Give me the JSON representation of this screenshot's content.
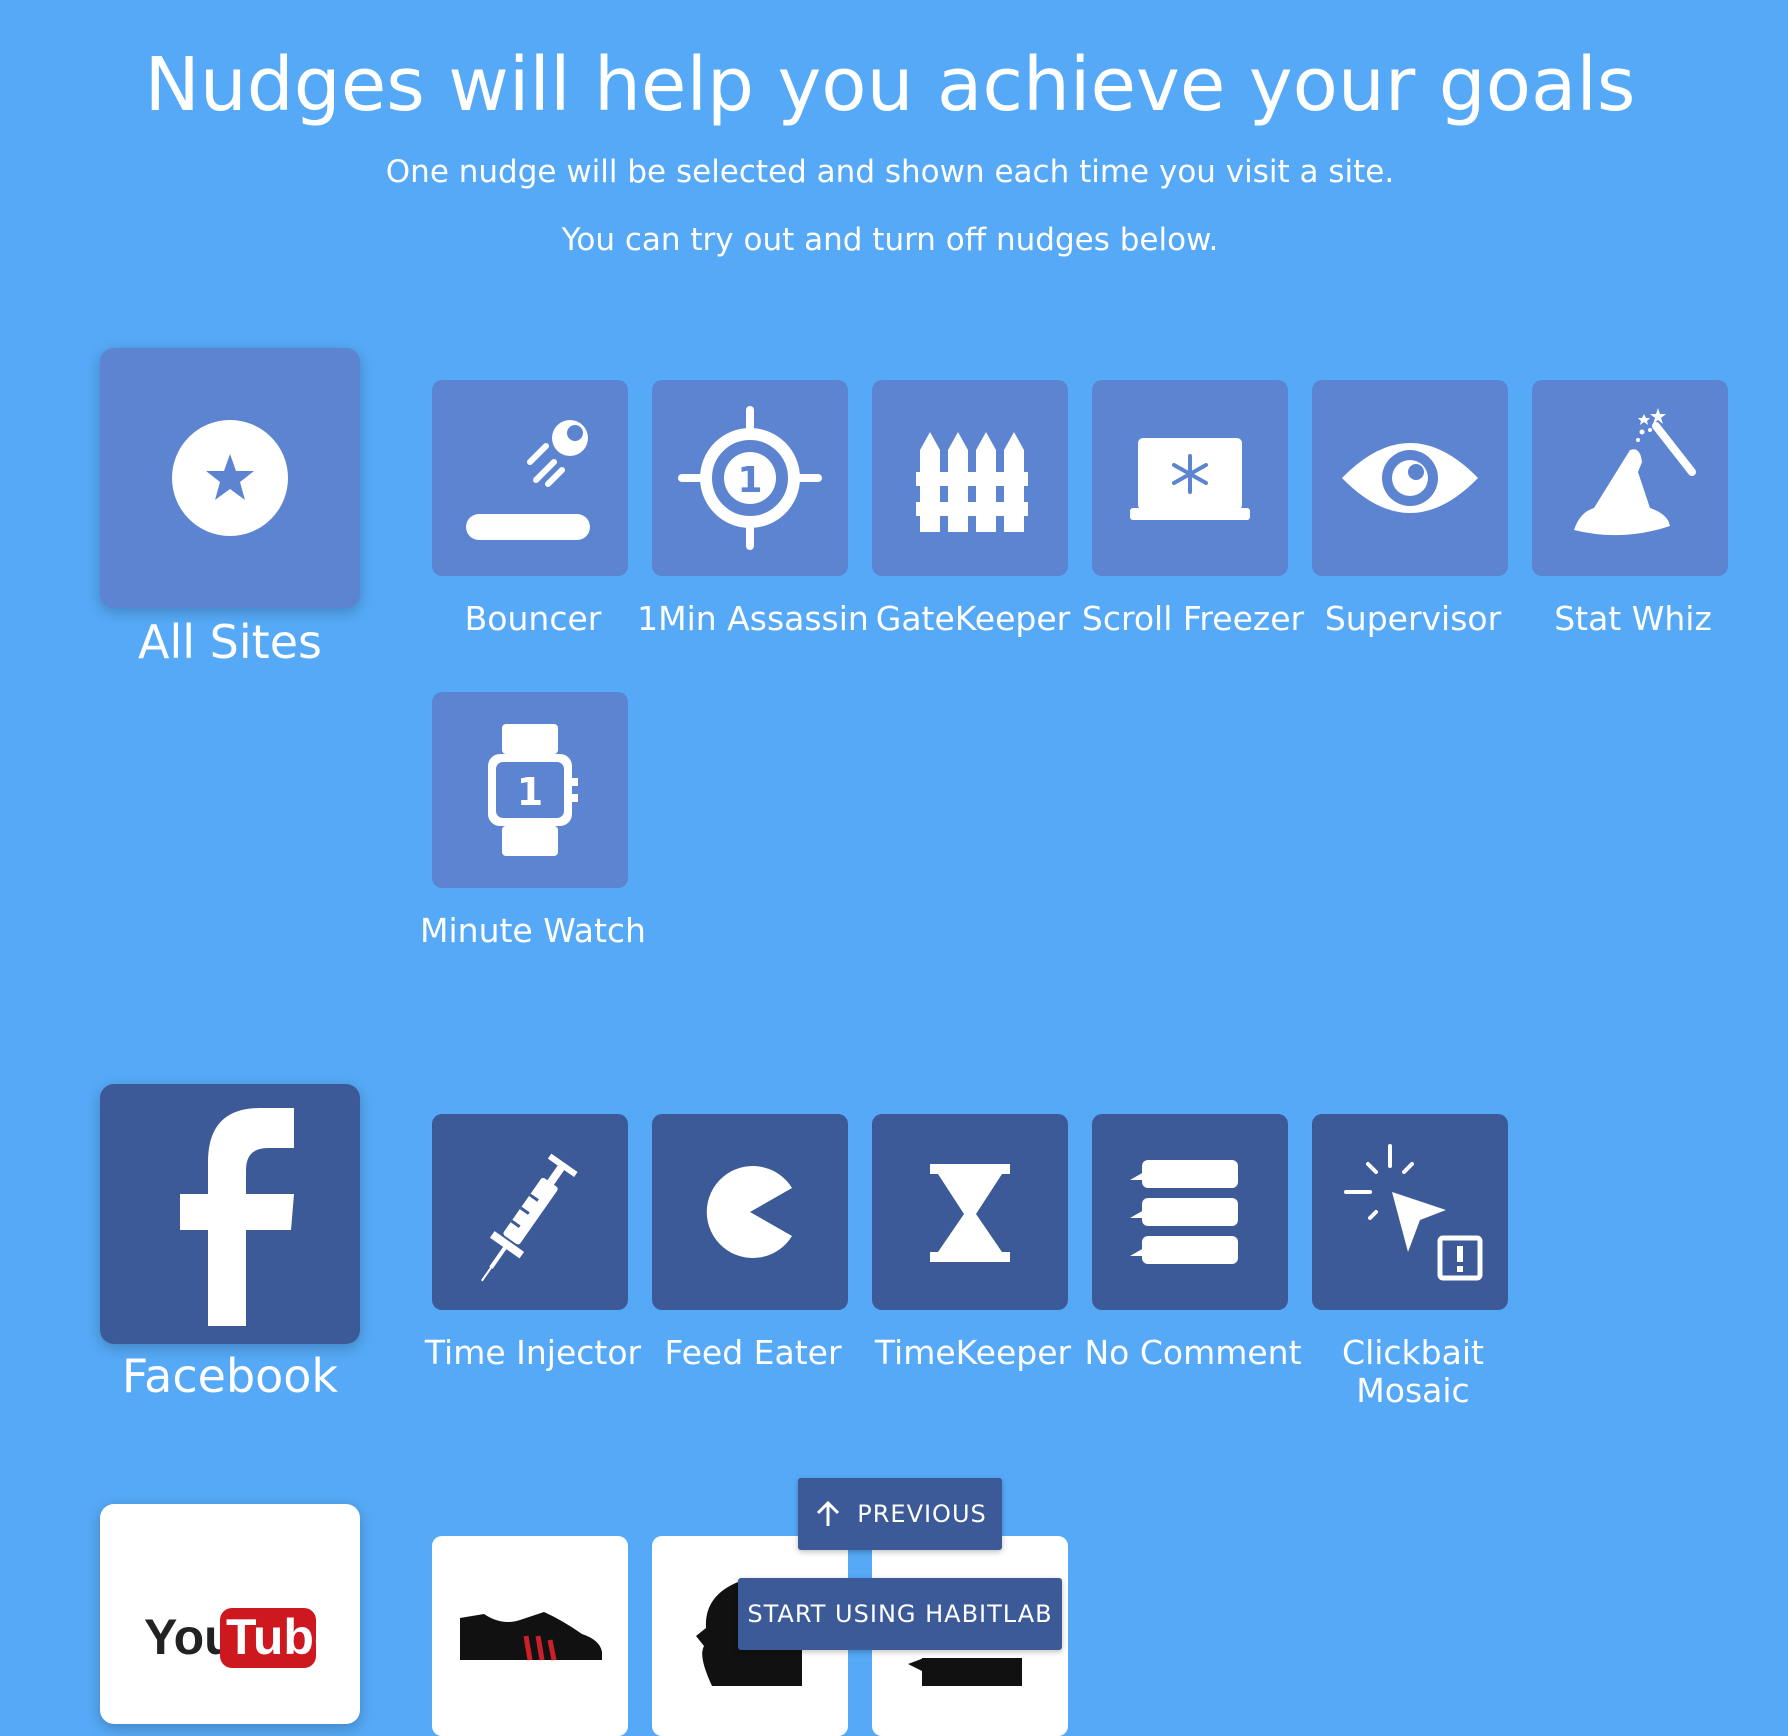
{
  "header": {
    "title": "Nudges will help you achieve your goals",
    "line1": "One nudge will be selected and shown each time you visit a site.",
    "line2": "You can try out and turn off nudges below."
  },
  "sites": [
    {
      "label": "All Sites",
      "icon": "star-circle-icon",
      "color": "#5c84d1",
      "nudges": [
        {
          "label": "Bouncer",
          "icon": "bouncer-icon"
        },
        {
          "label": "1Min Assassin",
          "icon": "crosshair-icon"
        },
        {
          "label": "GateKeeper",
          "icon": "fence-icon"
        },
        {
          "label": "Scroll Freezer",
          "icon": "laptop-snowflake-icon"
        },
        {
          "label": "Supervisor",
          "icon": "eye-icon"
        },
        {
          "label": "Stat Whiz",
          "icon": "wizard-hat-icon"
        },
        {
          "label": "Minute Watch",
          "icon": "smartwatch-icon"
        }
      ]
    },
    {
      "label": "Facebook",
      "icon": "facebook-icon",
      "color": "#3d5a98",
      "nudges": [
        {
          "label": "Time Injector",
          "icon": "syringe-icon"
        },
        {
          "label": "Feed Eater",
          "icon": "pacman-icon"
        },
        {
          "label": "TimeKeeper",
          "icon": "hourglass-icon"
        },
        {
          "label": "No Comment",
          "icon": "comments-icon"
        },
        {
          "label": "Clickbait Mosaic",
          "icon": "cursor-alert-icon"
        }
      ]
    },
    {
      "label": "YouTube",
      "logo_text": [
        "You",
        "Tube"
      ],
      "icon": "youtube-logo",
      "color": "#ffffff",
      "nudges": [
        {
          "icon": "sneaker-icon"
        },
        {
          "icon": "head-silhouette-icon"
        },
        {
          "icon": "block-icon"
        }
      ]
    }
  ],
  "buttons": {
    "previous": "PREVIOUS",
    "start": "START USING HABITLAB"
  },
  "colors": {
    "background": "#55a9f6",
    "general_tile": "#5c84d1",
    "facebook_tile": "#3d5a98",
    "button": "#3d5a98"
  }
}
